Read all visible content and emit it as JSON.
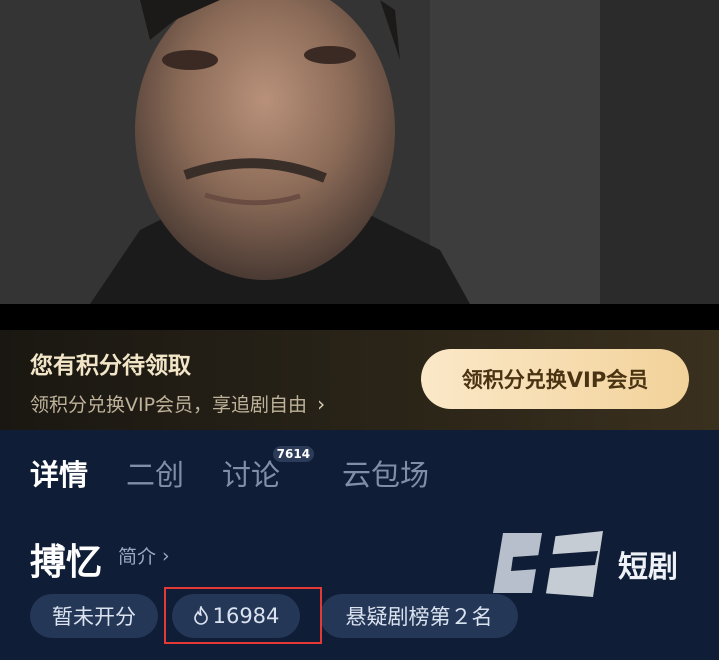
{
  "promo": {
    "title": "您有积分待领取",
    "subtitle": "领积分兑换VIP会员，享追剧自由",
    "button_label": "领积分兑换VIP会员"
  },
  "tabs": [
    {
      "label": "详情",
      "active": true
    },
    {
      "label": "二创",
      "active": false
    },
    {
      "label": "讨论",
      "badge": "7614",
      "active": false
    },
    {
      "label": "云包场",
      "active": false
    }
  ],
  "show": {
    "title": "搏忆",
    "intro_label": "简介",
    "tags": [
      {
        "label": "暂未开分"
      },
      {
        "label": "16984",
        "icon": "flame-icon"
      },
      {
        "label": "悬疑剧榜第２名"
      }
    ]
  },
  "logo": {
    "text": "十分短剧"
  },
  "colors": {
    "background": "#0f1d36",
    "promo_button": "#f2d29a",
    "tag_bg": "#253756",
    "highlight": "#e53935"
  }
}
